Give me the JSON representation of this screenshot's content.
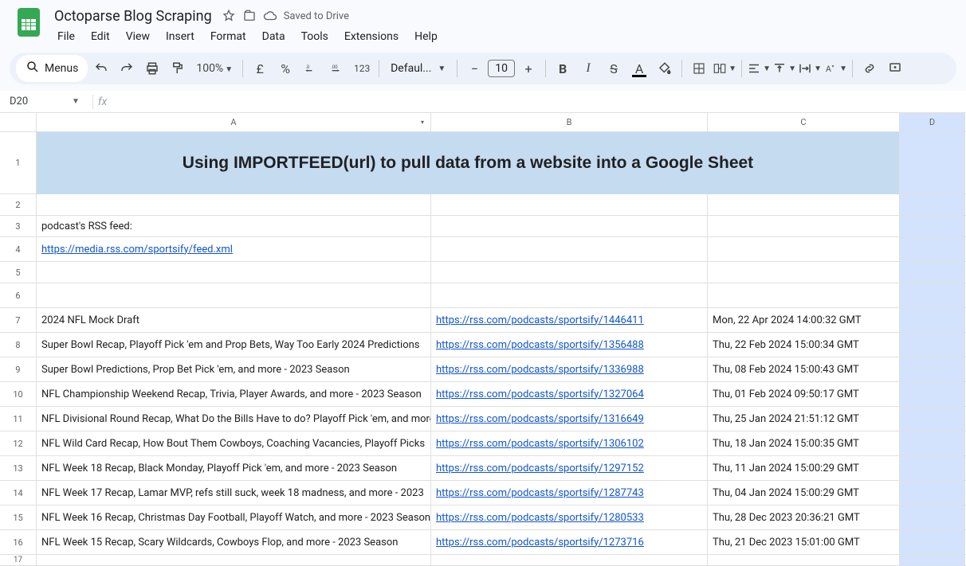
{
  "doc": {
    "title": "Octoparse Blog Scraping",
    "savedText": "Saved to Drive"
  },
  "menus": [
    "File",
    "Edit",
    "View",
    "Insert",
    "Format",
    "Data",
    "Tools",
    "Extensions",
    "Help"
  ],
  "toolbar": {
    "menusLabel": "Menus",
    "zoom": "100%",
    "currency": "£",
    "percent": "%",
    "numFormat": "123",
    "font": "Defaul...",
    "fontSize": "10"
  },
  "nameBox": "D20",
  "formula": "",
  "columns": [
    "A",
    "B",
    "C",
    "D"
  ],
  "sheet": {
    "headerTitle": "Using IMPORTFEED(url) to pull data from a website into a Google Sheet",
    "rssLabel": "podcast's RSS feed:",
    "rssUrl": "https://media.rss.com/sportsify/feed.xml",
    "rows": [
      {
        "title": "2024 NFL Mock Draft",
        "url": "https://rss.com/podcasts/sportsify/1446411",
        "date": "Mon, 22 Apr 2024 14:00:32 GMT"
      },
      {
        "title": "Super Bowl Recap, Playoff Pick 'em and Prop Bets, Way Too Early 2024 Predictions",
        "url": "https://rss.com/podcasts/sportsify/1356488",
        "date": "Thu, 22 Feb 2024 15:00:34 GMT"
      },
      {
        "title": "Super Bowl Predictions, Prop Bet Pick 'em, and more - 2023 Season",
        "url": "https://rss.com/podcasts/sportsify/1336988",
        "date": "Thu, 08 Feb 2024 15:00:43 GMT"
      },
      {
        "title": "NFL Championship Weekend Recap, Trivia, Player Awards, and more - 2023 Season",
        "url": "https://rss.com/podcasts/sportsify/1327064",
        "date": "Thu, 01 Feb 2024 09:50:17 GMT"
      },
      {
        "title": "NFL Divisional Round Recap, What Do the Bills Have to do? Playoff Pick 'em, and more",
        "url": "https://rss.com/podcasts/sportsify/1316649",
        "date": "Thu, 25 Jan 2024 21:51:12 GMT"
      },
      {
        "title": "NFL Wild Card Recap, How Bout Them Cowboys, Coaching Vacancies, Playoff Picks",
        "url": "https://rss.com/podcasts/sportsify/1306102",
        "date": "Thu, 18 Jan 2024 15:00:35 GMT"
      },
      {
        "title": "NFL Week 18 Recap, Black Monday, Playoff Pick 'em, and more - 2023 Season",
        "url": "https://rss.com/podcasts/sportsify/1297152",
        "date": "Thu, 11 Jan 2024 15:00:29 GMT"
      },
      {
        "title": "NFL Week 17 Recap, Lamar MVP, refs still suck, week 18 madness, and more - 2023",
        "url": "https://rss.com/podcasts/sportsify/1287743",
        "date": "Thu, 04 Jan 2024 15:00:29 GMT"
      },
      {
        "title": "NFL Week 16 Recap, Christmas Day Football, Playoff Watch, and more - 2023 Season",
        "url": "https://rss.com/podcasts/sportsify/1280533",
        "date": "Thu, 28 Dec 2023 20:36:21 GMT"
      },
      {
        "title": "NFL Week 15 Recap, Scary Wildcards, Cowboys Flop, and more - 2023 Season",
        "url": "https://rss.com/podcasts/sportsify/1273716",
        "date": "Thu, 21 Dec 2023 15:01:00 GMT"
      }
    ]
  }
}
